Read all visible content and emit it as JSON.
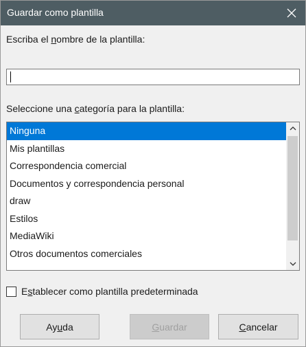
{
  "dialog": {
    "title": "Guardar como plantilla"
  },
  "name_field": {
    "label_pre": "Escriba el ",
    "label_key": "n",
    "label_post": "ombre de la plantilla:",
    "value": ""
  },
  "category": {
    "label_pre": "Seleccione una ",
    "label_key": "c",
    "label_post": "ategoría para la plantilla:",
    "selected_index": 0,
    "items": [
      "Ninguna",
      "Mis plantillas",
      "Correspondencia comercial",
      "Documentos y correspondencia personal",
      "draw",
      "Estilos",
      "MediaWiki",
      "Otros documentos comerciales"
    ]
  },
  "default_checkbox": {
    "label_pre": "E",
    "label_key": "s",
    "label_post": "tablecer como plantilla predeterminada",
    "checked": false
  },
  "buttons": {
    "help": {
      "pre": "Ay",
      "key": "u",
      "post": "da"
    },
    "save": {
      "pre": "",
      "key": "G",
      "post": "uardar",
      "enabled": false
    },
    "cancel": {
      "pre": "",
      "key": "C",
      "post": "ancelar"
    }
  },
  "colors": {
    "titlebar": "#4e5d63",
    "selection": "#0078d7",
    "dialog_bg": "#f0f0f0"
  },
  "icons": {
    "close": "close-icon",
    "scroll_up": "chevron-up-icon",
    "scroll_down": "chevron-down-icon"
  }
}
